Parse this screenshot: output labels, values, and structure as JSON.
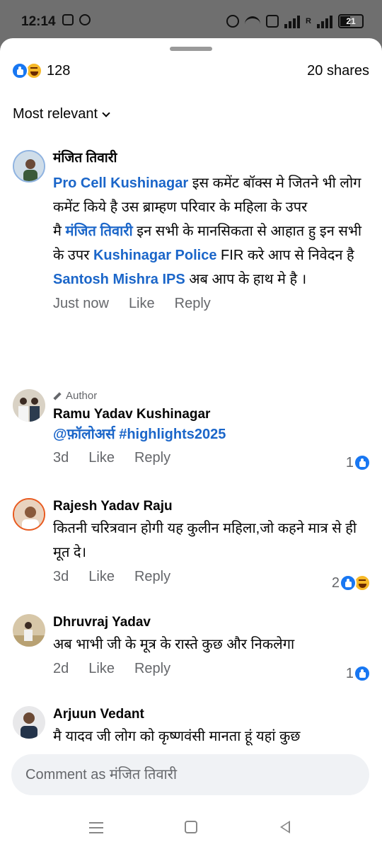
{
  "status_bar": {
    "time": "12:14",
    "battery": "21",
    "sim_label": "R"
  },
  "reactions": {
    "count": "128",
    "shares": "20 shares"
  },
  "sort": {
    "label": "Most relevant"
  },
  "comments": [
    {
      "name": "मंजित तिवारी",
      "text_parts": [
        {
          "t": "Pro Cell Kushinagar",
          "link": true
        },
        {
          "t": "  इस कमेंट बॉक्स मे जितने भी लोग कमेंट किये है उस ब्राम्हण परिवार के महिला के उपर",
          "link": false
        }
      ],
      "line2_prefix": "मै ",
      "line2_link1": "मंजित तिवारी",
      "line2_mid": " इन सभी के मानसिकता से आहात हु इन सभी के उपर ",
      "line2_link2": "Kushinagar Police",
      "line2_suffix": " FIR करे आप से निवेदन है",
      "line3_link": "Santosh Mishra IPS",
      "line3_suffix": " अब आप के हाथ मे है ।",
      "time": "Just now",
      "like": "Like",
      "reply": "Reply"
    },
    {
      "author_badge": "Author",
      "name": "Ramu Yadav Kushinagar",
      "text": "@फ़ॉलोअर्स #highlights2025",
      "time": "3d",
      "like": "Like",
      "reply": "Reply",
      "reaction_count": "1"
    },
    {
      "name": "Rajesh Yadav Raju",
      "text": "कितनी चरित्रवान होगी यह कुलीन महिला,जो कहने मात्र से ही मूत दे।",
      "time": "3d",
      "like": "Like",
      "reply": "Reply",
      "reaction_count": "2"
    },
    {
      "name": "Dhruvraj Yadav",
      "text": "अब भाभी जी के मूत्र के रास्ते कुछ और निकलेगा",
      "time": "2d",
      "like": "Like",
      "reply": "Reply",
      "reaction_count": "1"
    },
    {
      "name": "Arjuun Vedant",
      "text": "मै यादव जी लोग को कृष्णवंसी मानता हूं यहां कुछ"
    }
  ],
  "composer": {
    "placeholder": "Comment as मंजित तिवारी"
  },
  "colors": {
    "link": "#1b66c9",
    "like_blue": "#1877f2",
    "haha_yellow": "#f7b928",
    "muted": "#65676b"
  }
}
